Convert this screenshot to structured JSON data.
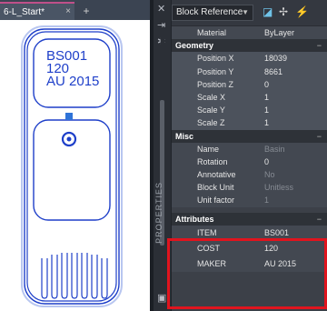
{
  "tab": {
    "label": "6-L_Start*",
    "close": "×",
    "add": "+"
  },
  "drawing": {
    "line1": "BS001",
    "line2": "120",
    "line3": "AU 2015"
  },
  "palette": {
    "title": "PROPERTIES",
    "selector": "Block Reference",
    "first_rows": [
      {
        "label": "Material",
        "value": "ByLayer"
      }
    ],
    "sections": [
      {
        "title": "Geometry",
        "toggle": "−",
        "rows": [
          {
            "label": "Position X",
            "value": "18039"
          },
          {
            "label": "Position Y",
            "value": "8661"
          },
          {
            "label": "Position Z",
            "value": "0"
          },
          {
            "label": "Scale X",
            "value": "1"
          },
          {
            "label": "Scale Y",
            "value": "1"
          },
          {
            "label": "Scale Z",
            "value": "1"
          }
        ]
      },
      {
        "title": "Misc",
        "toggle": "−",
        "rows": [
          {
            "label": "Name",
            "value": "Basin"
          },
          {
            "label": "Rotation",
            "value": "0"
          },
          {
            "label": "Annotative",
            "value": "No"
          },
          {
            "label": "Block Unit",
            "value": "Unitless"
          },
          {
            "label": "Unit factor",
            "value": "1"
          }
        ]
      },
      {
        "title": "Attributes",
        "toggle": "−",
        "rows": [
          {
            "label": "ITEM",
            "value": "BS001"
          },
          {
            "label": "COST",
            "value": "120"
          },
          {
            "label": "MAKER",
            "value": "AU 2015"
          }
        ]
      }
    ]
  },
  "colors": {
    "drawing_blue": "#1e3fc9",
    "highlight": "#e0141e",
    "panel_bg": "#3c4048"
  }
}
